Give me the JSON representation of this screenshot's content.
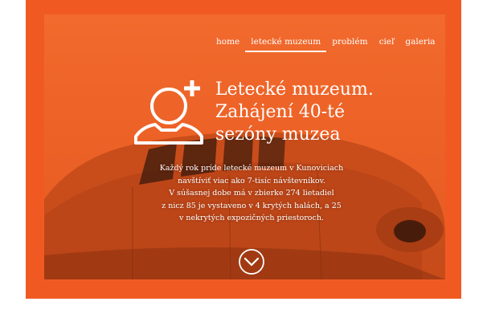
{
  "nav": {
    "items": [
      {
        "label": "home"
      },
      {
        "label": "letecké muzeum"
      },
      {
        "label": "problém"
      },
      {
        "label": "cieľ"
      },
      {
        "label": "galeria"
      }
    ],
    "active_index": 1
  },
  "hero": {
    "title_lines": [
      "Letecké muzeum.",
      "Zahájení 40-té",
      "sezóny muzea"
    ],
    "description_lines": [
      "Každý rok príde letecké muzeum v Kunoviciach",
      "navštíviť viac ako 7-tisíc návštevníkov.",
      "V súšasnej dobe má v zbierke 274 lietadiel",
      "z nicz 85 je vystaveno v 4 krytých halách, a 25",
      "v nekrytých expozičných priestoroch."
    ]
  },
  "icons": {
    "profile": "user-add-icon",
    "scroll": "chevron-down-circle-icon"
  },
  "colors": {
    "brand_orange": "#f05a22",
    "text": "#ffffff"
  }
}
